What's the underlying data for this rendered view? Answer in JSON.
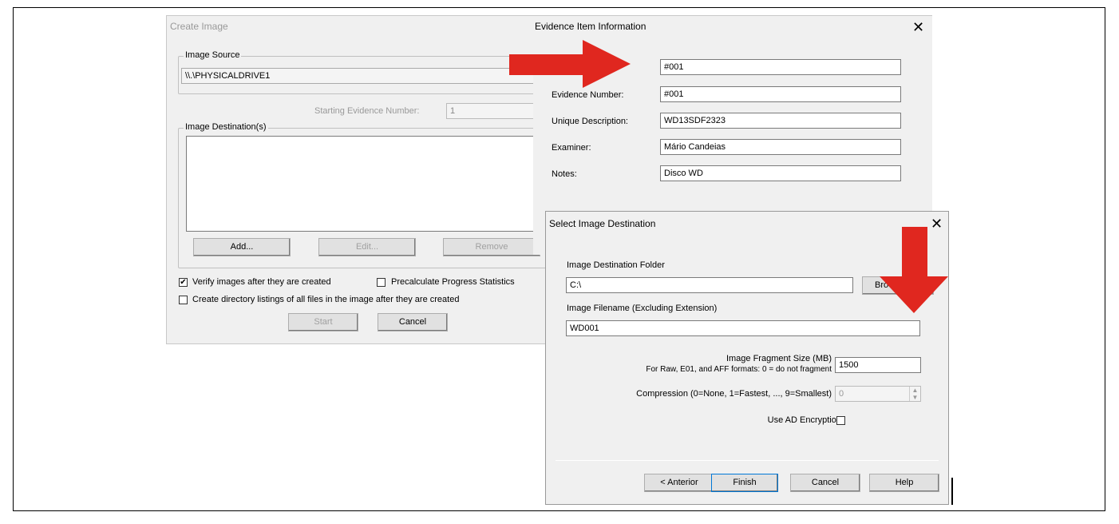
{
  "create_image": {
    "title": "Create Image",
    "image_source_legend": "Image Source",
    "image_source_value": "\\\\.\\PHYSICALDRIVE1",
    "starting_evidence_label": "Starting Evidence Number:",
    "starting_evidence_value": "1",
    "image_destinations_legend": "Image Destination(s)",
    "add_label": "Add...",
    "edit_label": "Edit...",
    "remove_label": "Remove",
    "verify_label": "Verify images after they are created",
    "verify_checked": "✔",
    "precalc_label": "Precalculate Progress Statistics",
    "dirlist_label": "Create directory listings of all files in the image after they are created",
    "start_label": "Start",
    "cancel_label": "Cancel"
  },
  "evidence_info": {
    "title": "Evidence Item Information",
    "close": "✕",
    "case_number_value": "#001",
    "evidence_number_label": "Evidence Number:",
    "evidence_number_value": "#001",
    "unique_description_label": "Unique Description:",
    "unique_description_value": "WD13SDF2323",
    "examiner_label": "Examiner:",
    "examiner_value": "Mário Candeias",
    "notes_label": "Notes:",
    "notes_value": "Disco WD"
  },
  "select_destination": {
    "title": "Select Image Destination",
    "close": "✕",
    "folder_label": "Image Destination Folder",
    "folder_value": "C:\\",
    "browse_label": "Bro",
    "filename_label": "Image Filename (Excluding Extension)",
    "filename_value": "WD001",
    "fragment_label_1": "Image Fragment Size (MB)",
    "fragment_label_2": "For Raw, E01, and AFF formats: 0 = do not fragment",
    "fragment_value": "1500",
    "compression_label": "Compression (0=None, 1=Fastest, ..., 9=Smallest)",
    "compression_value": "0",
    "encryption_label": "Use AD Encryption",
    "back_label": "< Anterior",
    "finish_label": "Finish",
    "cancel_label": "Cancel",
    "help_label": "Help"
  },
  "colors": {
    "arrow": "#e0271f",
    "window_bg": "#f0f0f0"
  }
}
